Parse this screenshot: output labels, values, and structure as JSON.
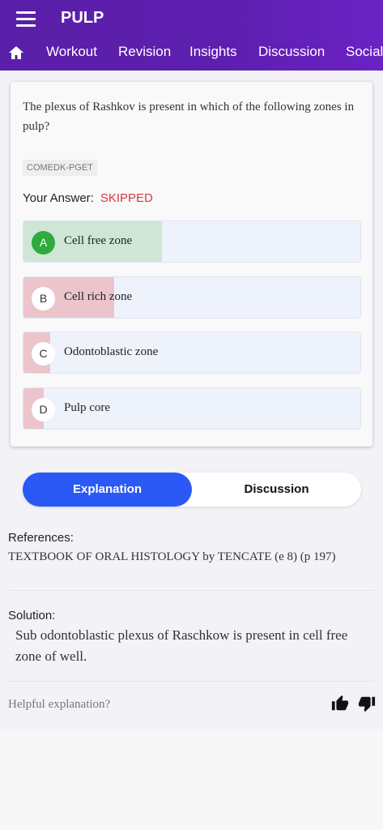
{
  "header": {
    "title": "PULP",
    "tabs": [
      "Workout",
      "Revision",
      "Insights",
      "Discussion",
      "Social"
    ]
  },
  "question": {
    "text": "The plexus of Rashkov is present in which of the following zones in pulp?",
    "exam": "COMEDK-PGET",
    "your_answer_label": "Your Answer:",
    "your_answer_value": "SKIPPED",
    "options": [
      {
        "letter": "A",
        "text": "Cell free zone",
        "fill_fraction": 0.41,
        "correct": true
      },
      {
        "letter": "B",
        "text": "Cell rich zone",
        "fill_fraction": 0.27,
        "correct": false
      },
      {
        "letter": "C",
        "text": "Odontoblastic zone",
        "fill_fraction": 0.08,
        "correct": false
      },
      {
        "letter": "D",
        "text": "Pulp core",
        "fill_fraction": 0.06,
        "correct": false
      }
    ]
  },
  "segment": {
    "active": "Explanation",
    "inactive": "Discussion"
  },
  "references": {
    "label": "References:",
    "text": "TEXTBOOK OF ORAL HISTOLOGY by TENCATE (e 8) (p 197)"
  },
  "solution": {
    "label": "Solution:",
    "text": "Sub odontoblastic plexus of Raschkow is present in cell free zone of well."
  },
  "feedback": {
    "prompt": "Helpful explanation?",
    "like_icon": "thumbs-up-icon",
    "dislike_icon": "thumbs-down-icon"
  },
  "colors": {
    "header": "#5e1fb0",
    "correct_fill": "#cfe6d6",
    "wrong_fill": "#ecc4cc",
    "correct_badge": "#2eaa3f",
    "skipped": "#e0313f",
    "segment_active": "#2b59f5"
  }
}
